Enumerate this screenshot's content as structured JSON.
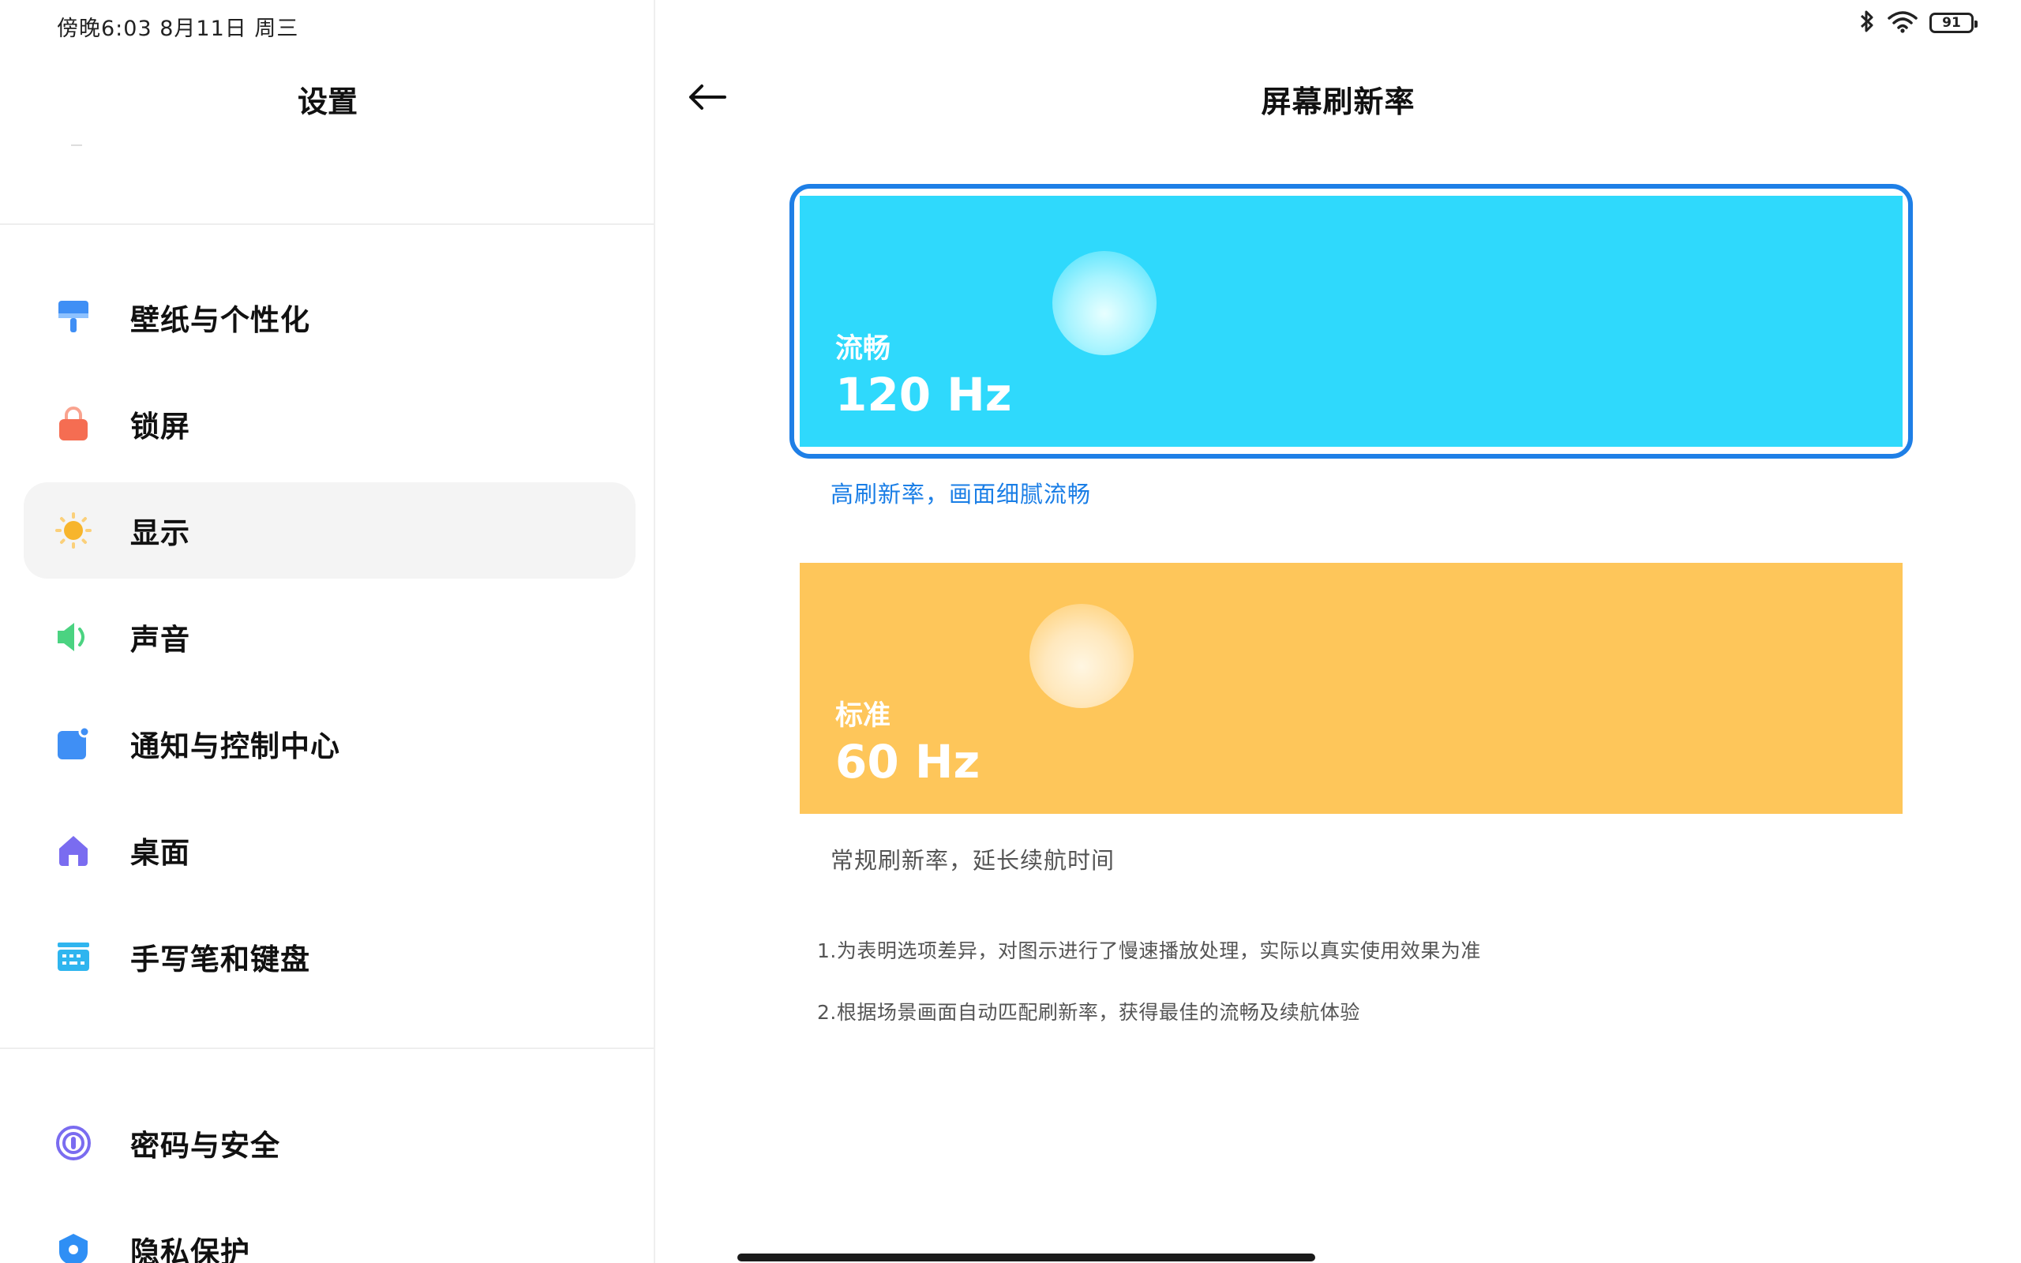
{
  "status_bar": {
    "time_text": "傍晚6:03  8月11日 周三",
    "battery_level": "91"
  },
  "sidebar": {
    "title": "设置",
    "items": [
      {
        "label": "壁纸与个性化",
        "icon": "wallpaper-brush-icon",
        "color": "#3f8ff5"
      },
      {
        "label": "锁屏",
        "icon": "lock-icon",
        "color": "#f56d52"
      },
      {
        "label": "显示",
        "icon": "sun-icon",
        "color": "#f7b52c",
        "active": true
      },
      {
        "label": "声音",
        "icon": "speaker-icon",
        "color": "#4bd381"
      },
      {
        "label": "通知与控制中心",
        "icon": "notification-icon",
        "color": "#3f8ff5"
      },
      {
        "label": "桌面",
        "icon": "home-icon",
        "color": "#7a6cf0"
      },
      {
        "label": "手写笔和键盘",
        "icon": "keyboard-icon",
        "color": "#2fb5ef"
      },
      {
        "label": "密码与安全",
        "icon": "fingerprint-icon",
        "color": "#7a6cf0"
      },
      {
        "label": "隐私保护",
        "icon": "privacy-icon",
        "color": "#2f8ff5"
      }
    ]
  },
  "main": {
    "title": "屏幕刷新率",
    "options": [
      {
        "name": "流畅",
        "hz": "120 Hz",
        "description": "高刷新率，画面细腻流畅",
        "selected": true,
        "color": "#2fd9fc"
      },
      {
        "name": "标准",
        "hz": "60 Hz",
        "description": "常规刷新率，延长续航时间",
        "selected": false,
        "color": "#fec65a"
      }
    ],
    "notes": [
      "1.为表明选项差异，对图示进行了慢速播放处理，实际以真实使用效果为准",
      "2.根据场景画面自动匹配刷新率，获得最佳的流畅及续航体验"
    ]
  },
  "accent_color": "#1e7fe6"
}
